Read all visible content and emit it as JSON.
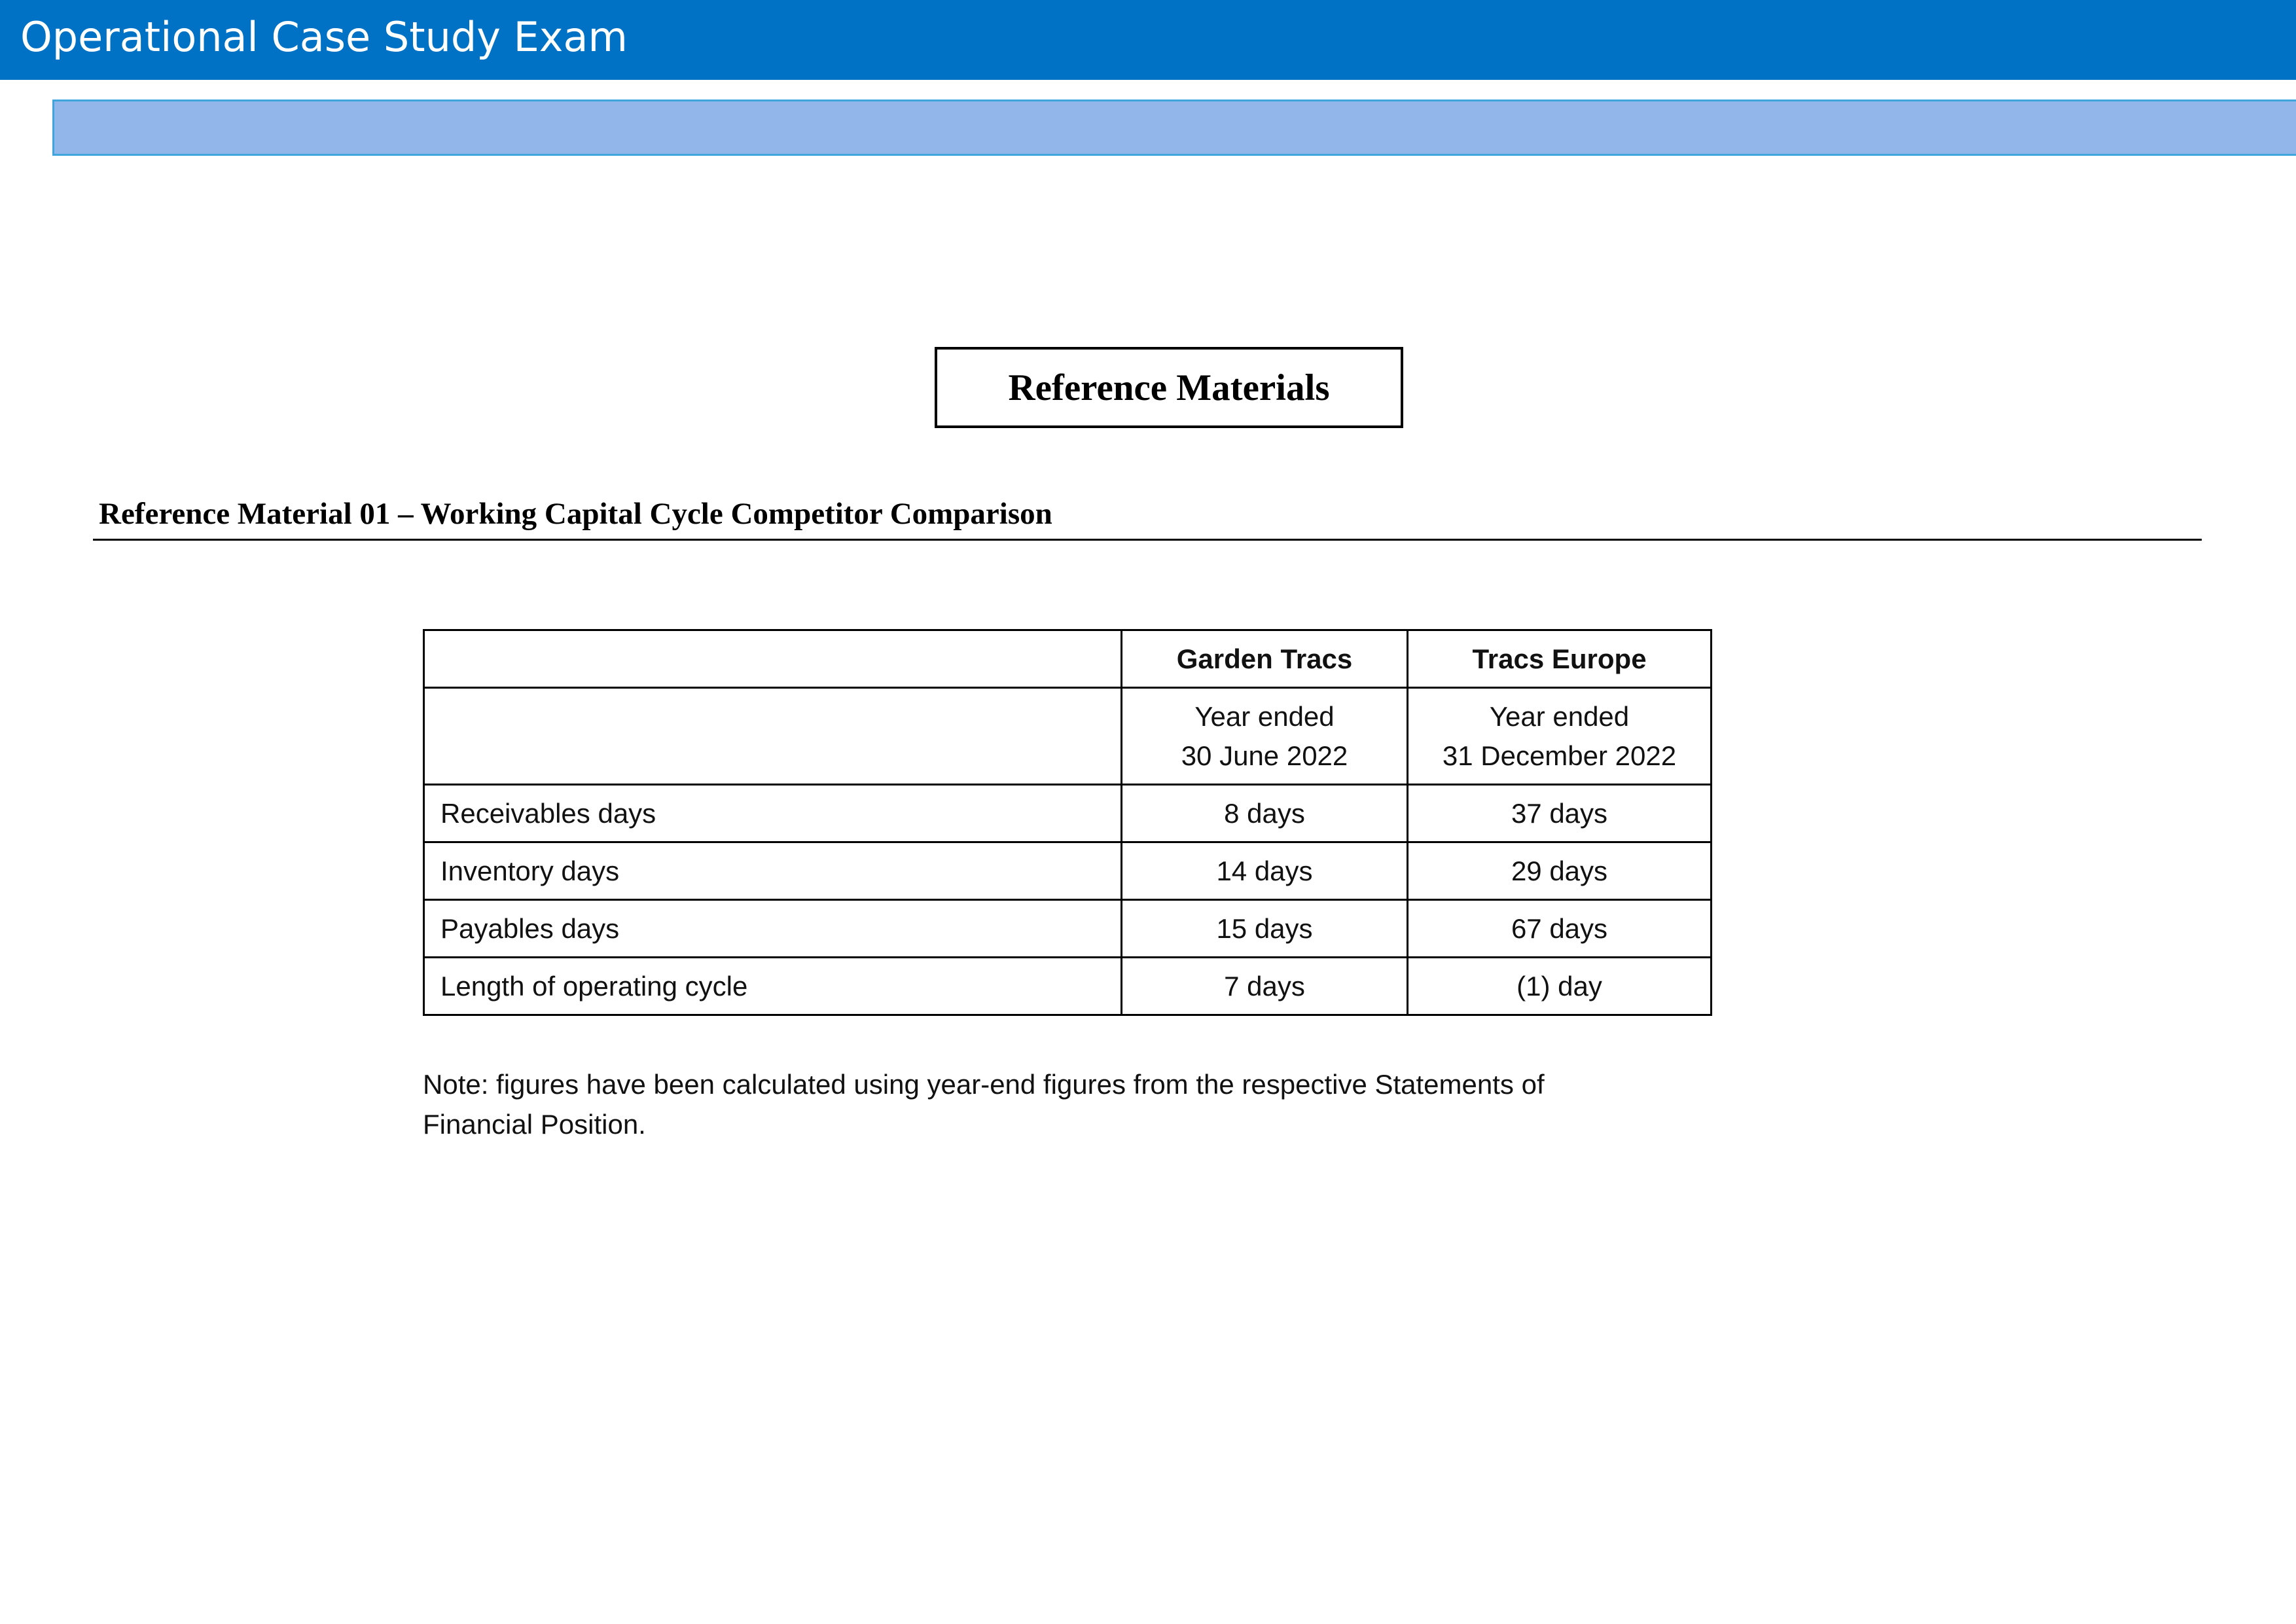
{
  "header": {
    "title": "Operational Case Study Exam"
  },
  "reference_box": {
    "title": "Reference Materials"
  },
  "section": {
    "heading": "Reference Material 01 – Working Capital Cycle Competitor Comparison"
  },
  "table": {
    "columns": [
      "",
      "Garden Tracs",
      "Tracs Europe"
    ],
    "period_row": {
      "label": "",
      "garden_line1": "Year ended",
      "garden_line2": "30 June 2022",
      "europe_line1": "Year ended",
      "europe_line2": "31 December 2022"
    },
    "rows": [
      {
        "label": "Receivables days",
        "garden": "8 days",
        "europe": "37 days"
      },
      {
        "label": "Inventory days",
        "garden": "14 days",
        "europe": "29 days"
      },
      {
        "label": "Payables days",
        "garden": "15 days",
        "europe": "67 days"
      },
      {
        "label": "Length of operating cycle",
        "garden": "7 days",
        "europe": "(1) day"
      }
    ]
  },
  "note": {
    "line1": "Note: figures have been calculated using year-end figures from the respective Statements of",
    "line2": "Financial Position."
  },
  "colors": {
    "header_bar": "#0072c6",
    "sub_bar": "#92b6e9",
    "sub_bar_border": "#3ea6dc"
  }
}
